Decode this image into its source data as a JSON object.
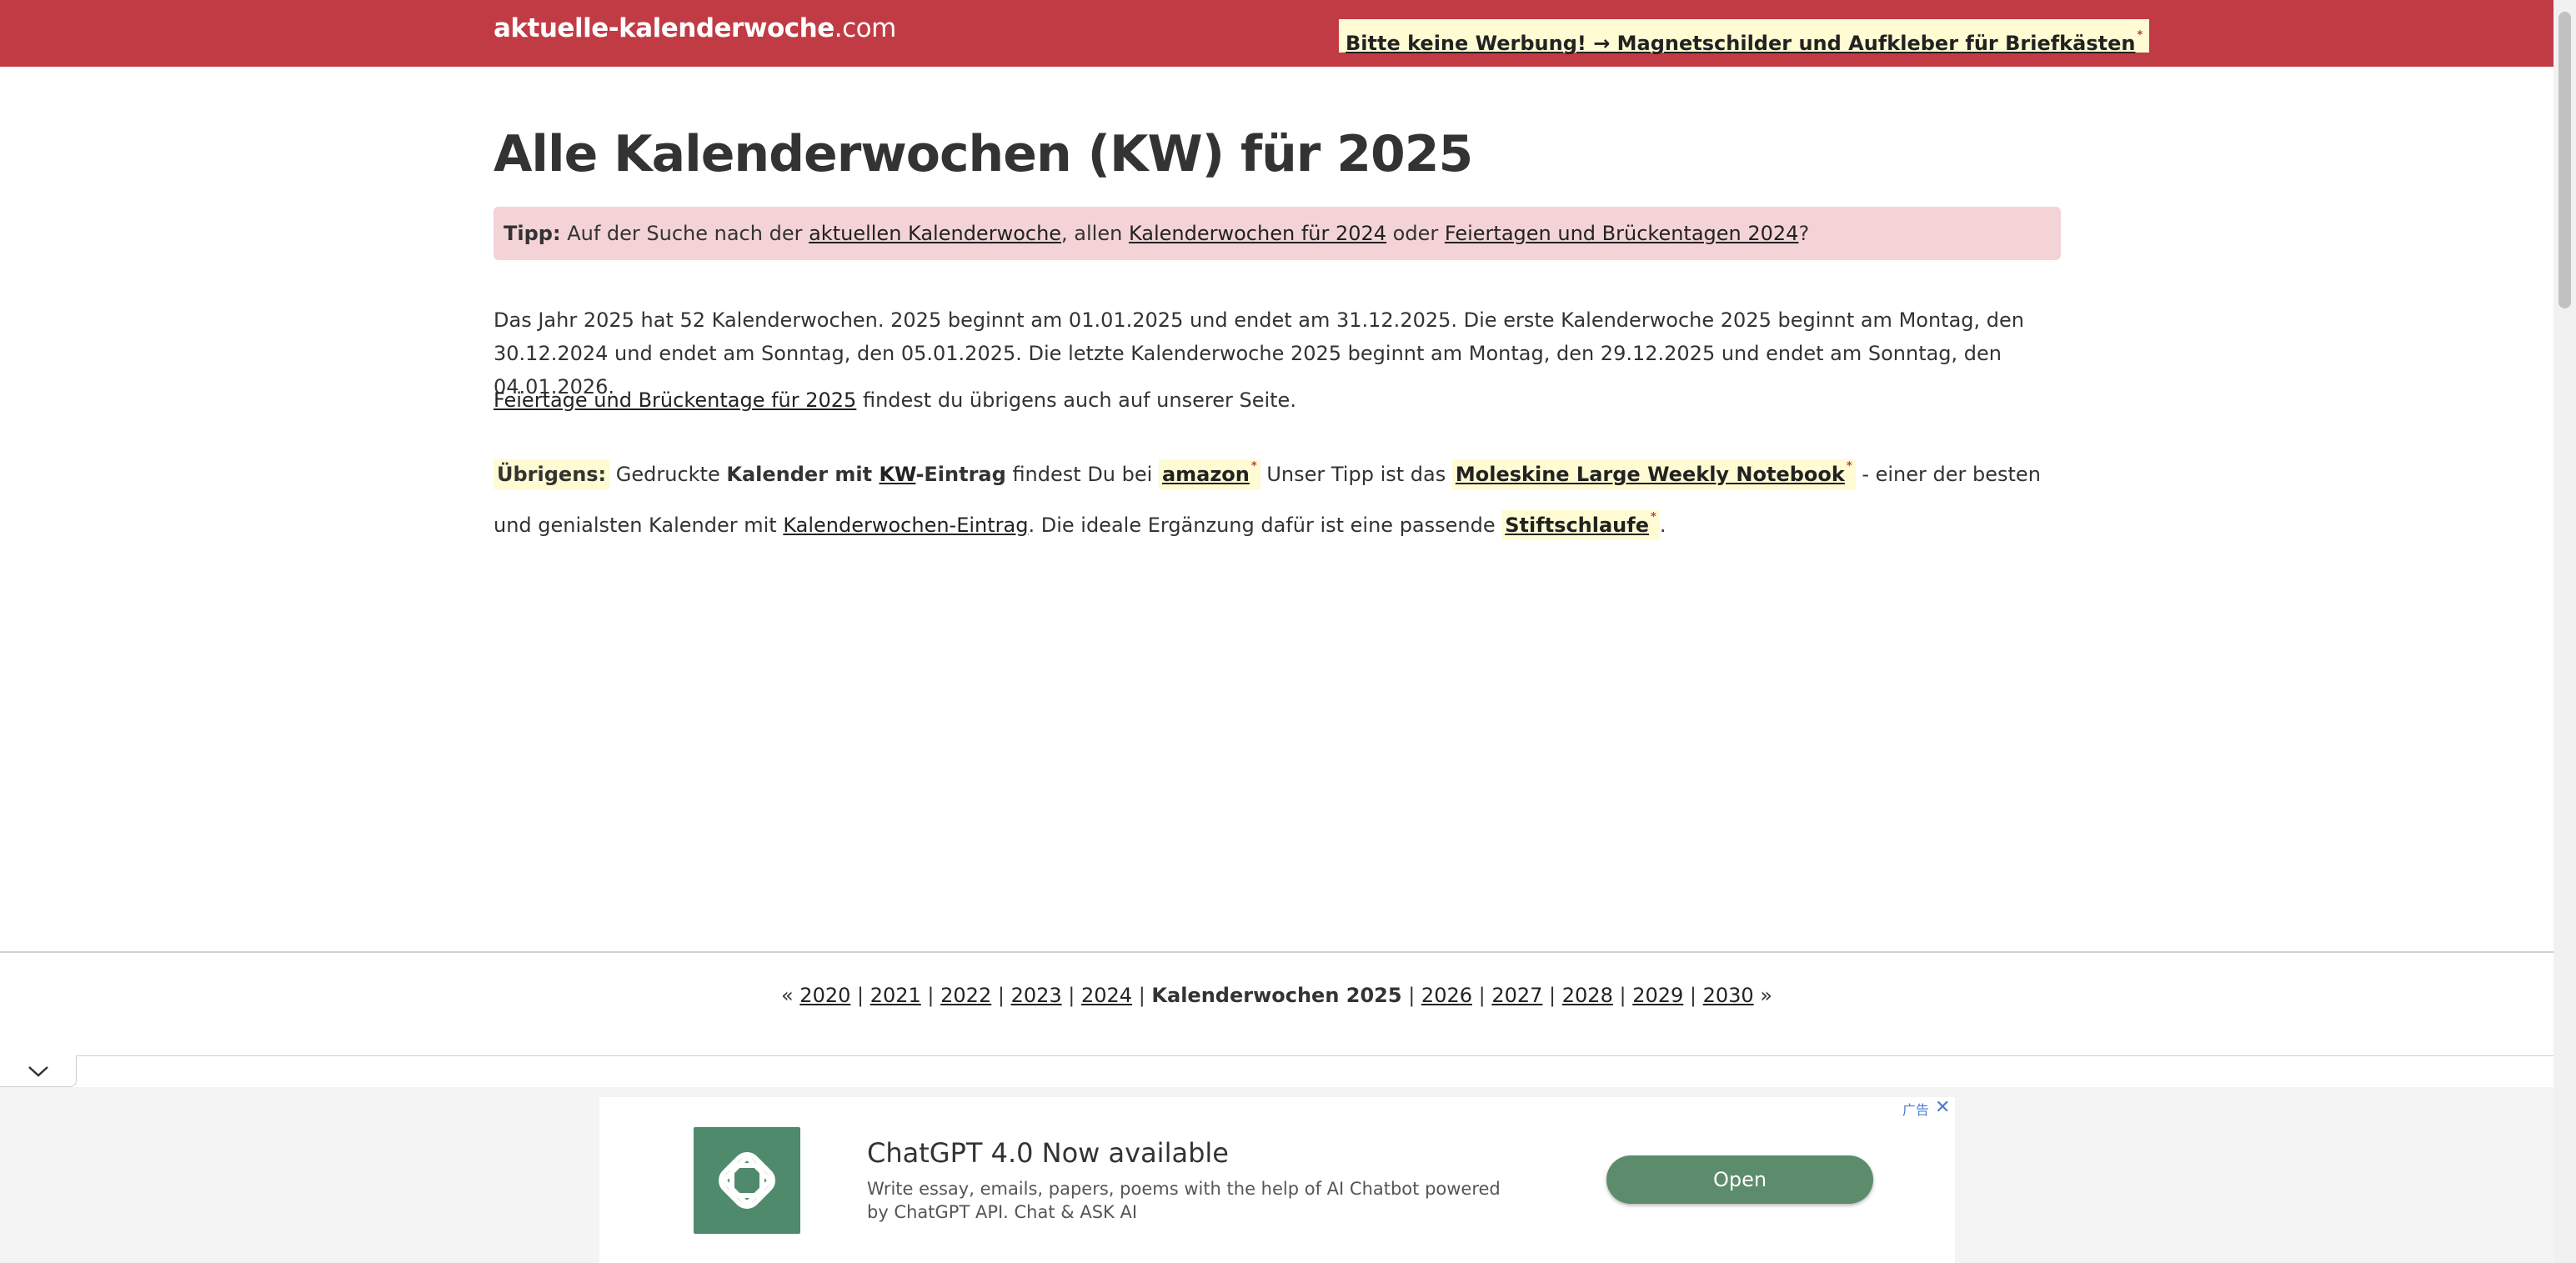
{
  "header": {
    "logo_bold": "aktuelle-kalenderwoche",
    "logo_tld": ".com",
    "promo_label": "Bitte keine Werbung! → Magnetschilder und Aufkleber für Briefkästen",
    "promo_mark": "*",
    "colors": {
      "bar": "#c13b45",
      "promo_bg": "#fffbd2"
    }
  },
  "page": {
    "title": "Alle Kalenderwochen (KW) für 2025"
  },
  "tip": {
    "label": "Tipp:",
    "text1": " Auf der Suche nach der ",
    "link1": "aktuellen Kalenderwoche",
    "text2": ", allen ",
    "link2": "Kalenderwochen für 2024",
    "text3": " oder ",
    "link3": "Feiertagen und Brückentagen 2024",
    "text4": "?",
    "bg": "#f4d3d7"
  },
  "intro": "Das Jahr 2025 hat 52 Kalenderwochen. 2025 beginnt am 01.01.2025 und endet am 31.12.2025. Die erste Kalenderwoche 2025 beginnt am Montag, den 30.12.2024 und endet am Sonntag, den 05.01.2025. Die letzte Kalenderwoche 2025 beginnt am Montag, den 29.12.2025 und endet am Sonntag, den 04.01.2026.",
  "holidays": {
    "link": "Feiertage und Brückentage für 2025",
    "text": " findest du übrigens auch auf unserer Seite."
  },
  "tip2": {
    "label": "Übrigens:",
    "text1": " Gedruckte ",
    "bold1": "Kalender mit ",
    "kw_link": "KW",
    "bold2": "-Eintrag",
    "text2": " findest Du bei ",
    "amazon_link": "amazon",
    "text3": " Unser Tipp ist das ",
    "moleskine_link": "Moleskine Large Weekly Notebook",
    "text4": " - einer der besten und genialsten Kalender mit ",
    "kalender_link": "Kalenderwochen-Eintrag",
    "text5": ". Die ideale Ergänzung dafür ist eine passende ",
    "stift_link": "Stiftschlaufe",
    "text6": ".",
    "mark": "*"
  },
  "year_nav": {
    "prev": "«",
    "next": "»",
    "sep": " | ",
    "years_before": [
      "2020",
      "2021",
      "2022",
      "2023",
      "2024"
    ],
    "current": "Kalenderwochen 2025",
    "years_after": [
      "2026",
      "2027",
      "2028",
      "2029",
      "2030"
    ]
  },
  "ad": {
    "title": "ChatGPT 4.0 Now available",
    "description": "Write essay, emails, papers, poems with the help of AI Chatbot powered by ChatGPT API. Chat & ASK AI",
    "button": "Open",
    "badge": "广告",
    "close": "✕",
    "button_color": "#5c8c6c",
    "logo_color": "#4f8a6c",
    "logo_icon": "openai-knot-icon",
    "collapse_icon": "chevron-down-icon"
  }
}
